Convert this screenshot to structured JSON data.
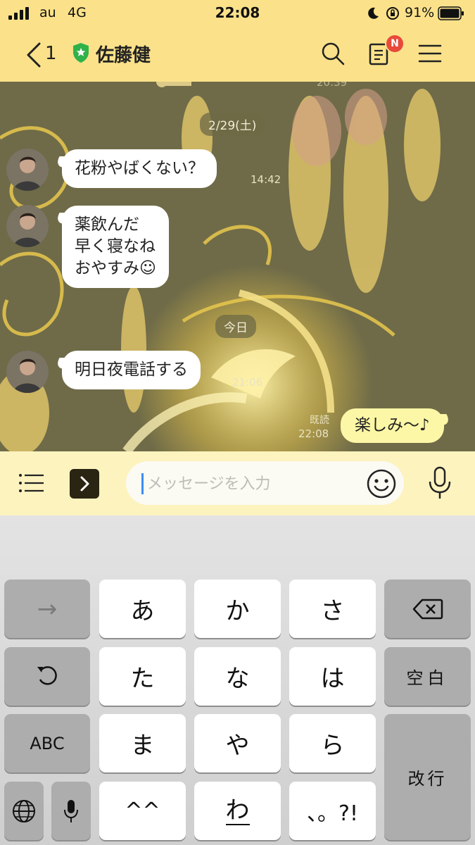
{
  "status_bar": {
    "carrier": "au",
    "network": "4G",
    "time": "22:08",
    "battery_percent": "91%",
    "icons": [
      "signal-bars-icon",
      "moon-icon",
      "rotation-lock-icon",
      "battery-icon"
    ]
  },
  "header": {
    "back_count": "1",
    "contact_name": "佐藤健",
    "badge_letter": "N",
    "accent_color": "#fbe28a",
    "badge_color": "#e8493a"
  },
  "chat": {
    "faded_time_top": "20:39",
    "dates": {
      "first": "2/29(土)",
      "second": "今日"
    },
    "messages": [
      {
        "side": "left",
        "text": "花粉やばくない？",
        "time": "14:42"
      },
      {
        "side": "left",
        "text": "薬飲んだ\n早く寝なね\nおやすみ☺",
        "time": ""
      },
      {
        "side": "left",
        "text": "明日夜電話する",
        "time": "21:06"
      },
      {
        "side": "right",
        "text": "楽しみ〜♪",
        "time": "22:08",
        "read": "既読"
      }
    ]
  },
  "input_bar": {
    "placeholder": "メッセージを入力",
    "value": ""
  },
  "keyboard": {
    "rows": [
      [
        "→",
        "あ",
        "か",
        "さ",
        "⌫"
      ],
      [
        "↺",
        "た",
        "な",
        "は",
        "空白"
      ],
      [
        "ABC",
        "ま",
        "や",
        "ら",
        "改行"
      ],
      [
        "globe-icon",
        "mic-icon",
        "^^",
        "わ",
        "、。?!"
      ]
    ],
    "labels": {
      "arrow": "→",
      "a": "あ",
      "ka": "か",
      "sa": "さ",
      "ta": "た",
      "na": "な",
      "ha": "は",
      "space": "空白",
      "abc": "ABC",
      "ma": "ま",
      "ya": "や",
      "ra": "ら",
      "enter": "改行",
      "emoticon": "^^",
      "wa": "わ",
      "punct": "、。?!"
    }
  }
}
